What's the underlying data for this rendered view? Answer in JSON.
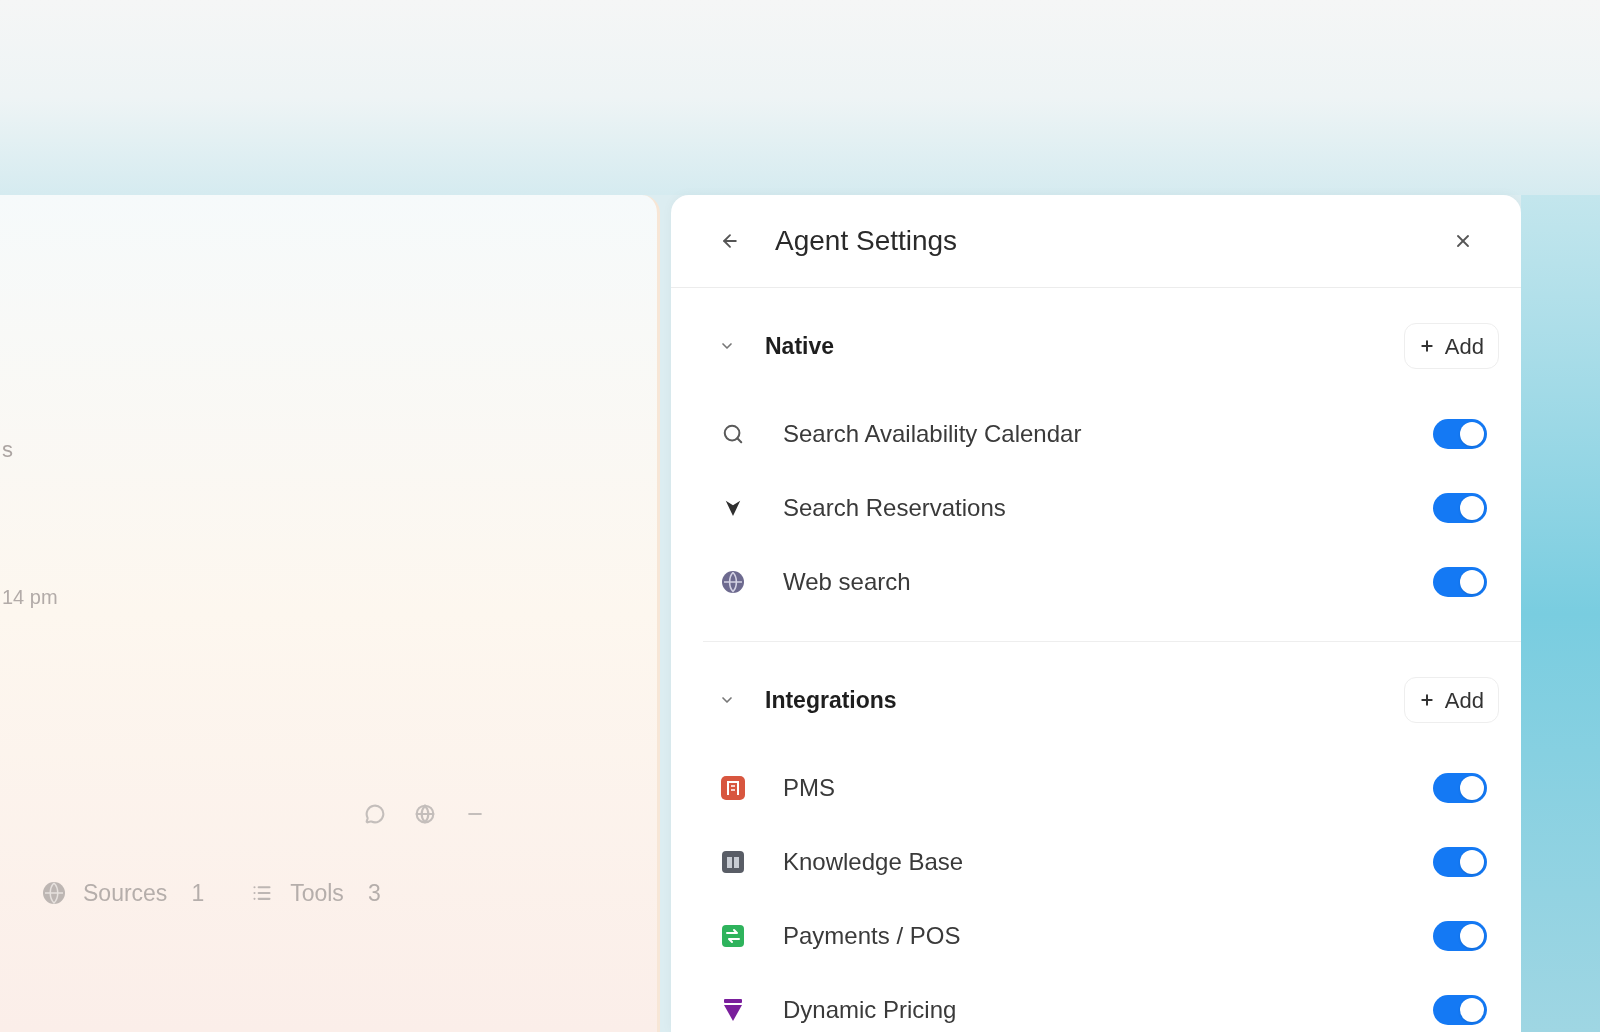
{
  "background_panel": {
    "message_fragment": "s",
    "timestamp_fragment": "14 pm",
    "footer_buttons": [
      {
        "kind": "sources",
        "label": "Sources",
        "count": "1"
      },
      {
        "kind": "tools",
        "label": "Tools",
        "count": "3"
      }
    ]
  },
  "settings_panel": {
    "title": "Agent Settings",
    "sections": [
      {
        "title": "Native",
        "expanded": true,
        "add_label": "Add",
        "items": [
          {
            "kind": "search",
            "label": "Search Availability Calendar",
            "on": true
          },
          {
            "kind": "reservations",
            "label": "Search Reservations",
            "on": true
          },
          {
            "kind": "web",
            "label": "Web search",
            "on": true
          }
        ]
      },
      {
        "title": "Integrations",
        "expanded": true,
        "add_label": "Add",
        "items": [
          {
            "kind": "pms",
            "label": "PMS",
            "on": true
          },
          {
            "kind": "knowledge",
            "label": "Knowledge Base",
            "on": true
          },
          {
            "kind": "payments",
            "label": "Payments / POS",
            "on": true
          },
          {
            "kind": "pricing",
            "label": "Dynamic Pricing",
            "on": true
          }
        ]
      }
    ]
  }
}
